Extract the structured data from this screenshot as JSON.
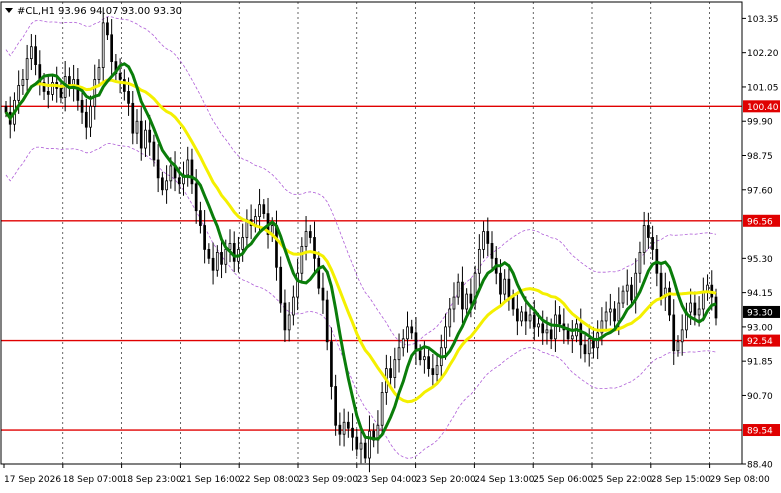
{
  "header": {
    "symbol": "#CL,H1",
    "ohlc": "93.96 94.07 93.00 93.30",
    "menu_icon": "triangle-down-icon"
  },
  "colors": {
    "background": "#ffffff",
    "frame": "#000000",
    "grid": "#000000",
    "candle": "#000000",
    "level_line": "#e00000",
    "level_label_bg": "#e00000",
    "level_label_text": "#ffffff",
    "ma_fast": "#0a7d0a",
    "ma_slow": "#f4f000",
    "envelope": "#b060d8",
    "price_label_bg": "#000000",
    "price_label_text": "#ffffff"
  },
  "chart_data": {
    "type": "candlestick",
    "title": "#CL,H1",
    "ohlc_last": {
      "open": 93.96,
      "high": 94.07,
      "low": 93.0,
      "close": 93.3
    },
    "x_tick_labels": [
      "17 Sep 2026",
      "18 Sep 07:00",
      "18 Sep 23:00",
      "21 Sep 16:00",
      "22 Sep 08:00",
      "23 Sep 09:00",
      "23 Sep 04:00",
      "23 Sep 20:00",
      "24 Sep 13:00",
      "25 Sep 06:00",
      "25 Sep 22:00",
      "28 Sep 15:00",
      "29 Sep 08:00"
    ],
    "y_tick_labels": [
      "103.35",
      "102.20",
      "101.05",
      "99.90",
      "98.75",
      "97.60",
      "95.30",
      "94.15",
      "93.00",
      "91.85",
      "90.70",
      "88.40"
    ],
    "ylim": [
      88.4,
      103.9
    ],
    "grid": "vertical dashed",
    "levels": [
      {
        "label": "100.40",
        "value": 100.4
      },
      {
        "label": "96.56",
        "value": 96.56
      },
      {
        "label": "92.54",
        "value": 92.54
      },
      {
        "label": "89.54",
        "value": 89.54
      }
    ],
    "current_price": {
      "label": "93.30",
      "value": 93.3
    },
    "closes": [
      100.2,
      99.8,
      100.6,
      101.1,
      101.3,
      102.0,
      102.4,
      101.8,
      101.2,
      100.9,
      100.8,
      101.2,
      101.0,
      100.7,
      101.4,
      101.0,
      101.3,
      100.6,
      100.2,
      99.7,
      100.4,
      101.3,
      101.7,
      103.2,
      102.8,
      101.9,
      101.5,
      101.3,
      100.9,
      100.5,
      99.5,
      99.9,
      99.0,
      99.6,
      99.2,
      98.6,
      98.0,
      97.6,
      97.9,
      98.4,
      98.0,
      97.8,
      98.1,
      98.6,
      97.8,
      96.9,
      96.4,
      95.6,
      95.3,
      94.9,
      95.5,
      95.1,
      95.6,
      95.8,
      95.2,
      95.6,
      96.0,
      96.6,
      96.4,
      96.7,
      97.1,
      96.8,
      96.1,
      96.4,
      95.0,
      93.8,
      92.9,
      93.4,
      94.0,
      94.8,
      95.7,
      96.2,
      96.0,
      95.3,
      94.3,
      93.9,
      92.5,
      91.0,
      89.7,
      89.4,
      89.8,
      89.6,
      89.3,
      88.9,
      89.1,
      88.6,
      89.5,
      89.2,
      89.7,
      90.8,
      91.6,
      91.3,
      91.9,
      92.3,
      92.6,
      93.0,
      92.8,
      92.2,
      91.9,
      92.0,
      91.6,
      91.4,
      91.7,
      92.3,
      93.0,
      93.6,
      94.0,
      94.5,
      93.6,
      94.1,
      93.8,
      94.8,
      95.6,
      96.2,
      95.8,
      95.3,
      94.8,
      94.1,
      94.6,
      94.0,
      93.6,
      93.2,
      93.5,
      93.2,
      93.4,
      93.0,
      93.1,
      92.8,
      92.9,
      92.6,
      93.4,
      93.1,
      92.9,
      92.6,
      92.7,
      93.1,
      92.4,
      92.1,
      92.6,
      92.3,
      92.8,
      93.2,
      93.5,
      93.6,
      93.2,
      93.8,
      94.2,
      94.4,
      93.9,
      94.8,
      95.5,
      96.4,
      96.0,
      95.6,
      94.8,
      94.0,
      94.3,
      93.4,
      92.2,
      92.5,
      92.9,
      93.5,
      93.8,
      93.4,
      93.6,
      94.2,
      94.4,
      94.0,
      93.3
    ],
    "series": [
      {
        "name": "",
        "kind": "moving-average-fast",
        "color": "#0a7d0a"
      },
      {
        "name": "",
        "kind": "moving-average-slow",
        "color": "#f4f000"
      },
      {
        "name": "",
        "kind": "envelope-bands",
        "color": "#b060d8"
      }
    ]
  }
}
